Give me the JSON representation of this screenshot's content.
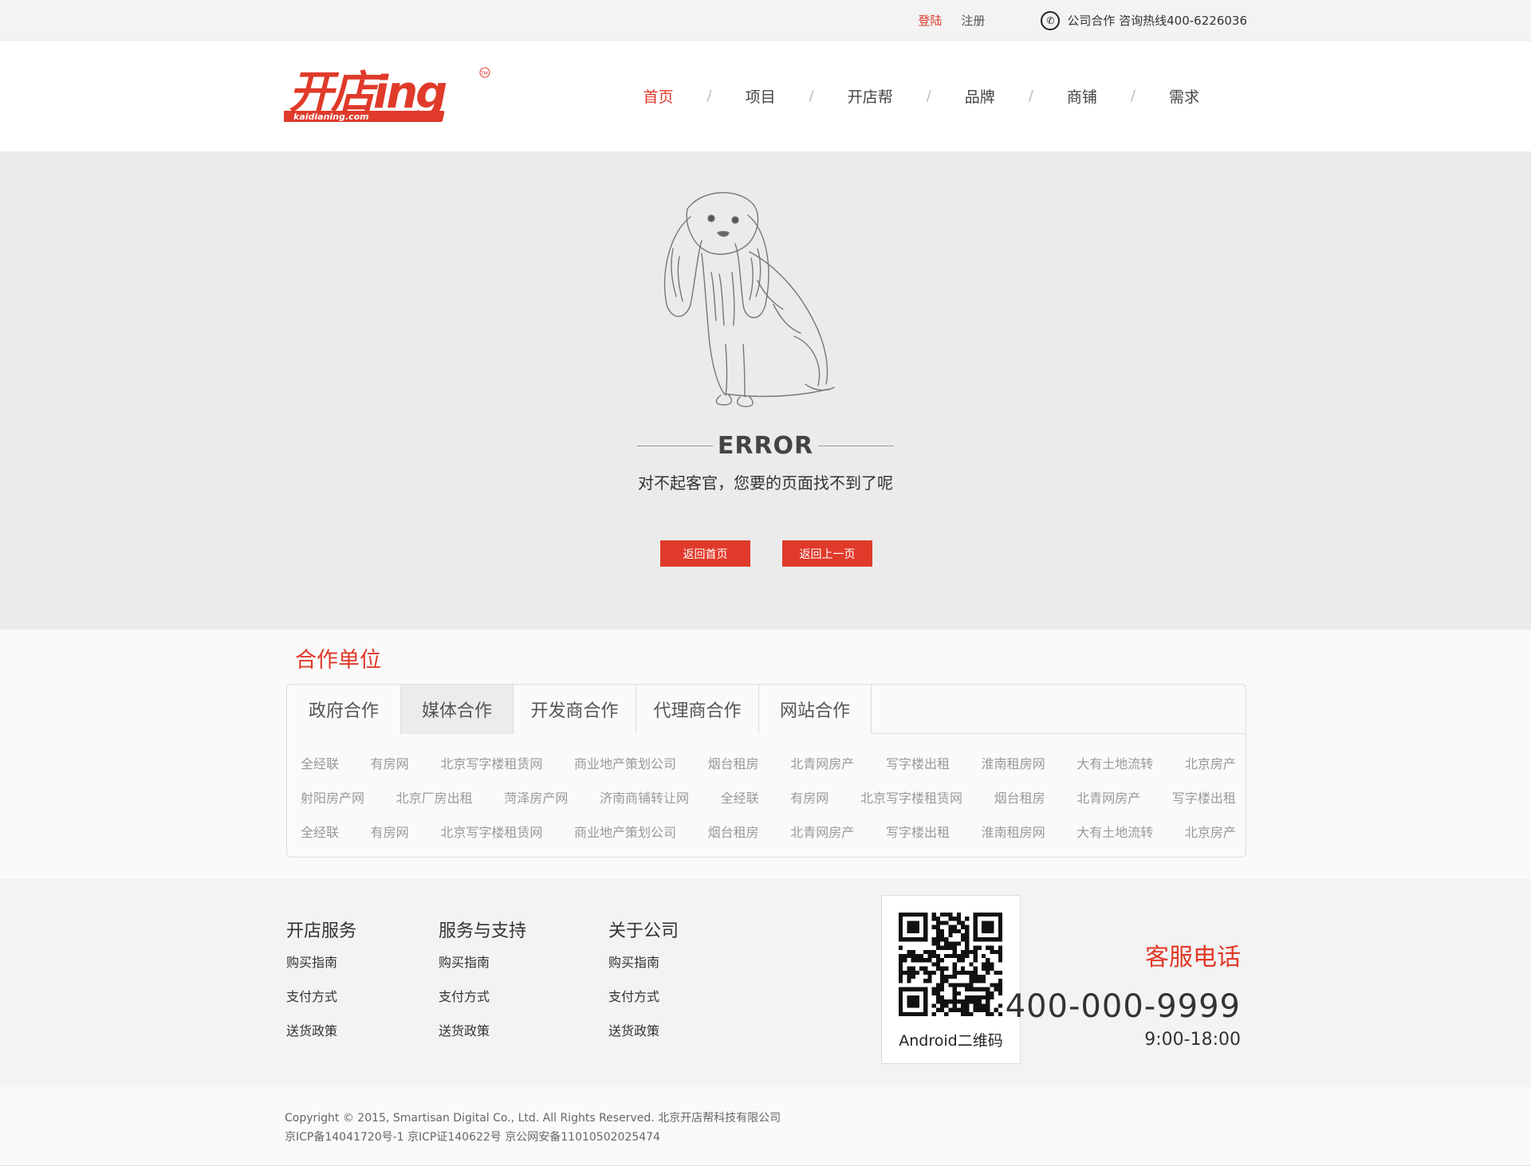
{
  "topbar": {
    "login": "登陆",
    "register": "注册",
    "hotline": "公司合作 咨询热线400-6226036"
  },
  "logo": {
    "text": "开店ing",
    "sub": "kaidianing.com",
    "mark": "TM"
  },
  "nav": {
    "items": [
      "首页",
      "项目",
      "开店帮",
      "品牌",
      "商铺",
      "需求"
    ],
    "separator": "/"
  },
  "error": {
    "title": "ERROR",
    "message": "对不起客官，您要的页面找不到了呢",
    "btn_home": "返回首页",
    "btn_back": "返回上一页"
  },
  "partners": {
    "title": "合作单位",
    "tabs": [
      "政府合作",
      "媒体合作",
      "开发商合作",
      "代理商合作",
      "网站合作"
    ],
    "active_tab": "媒体合作",
    "rows": [
      [
        "全经联",
        "有房网",
        "北京写字楼租赁网",
        "商业地产策划公司",
        "烟台租房",
        "北青网房产",
        "写字楼出租",
        "淮南租房网",
        "大有土地流转",
        "北京房产"
      ],
      [
        "射阳房产网",
        "北京厂房出租",
        "菏泽房产网",
        "济南商铺转让网",
        "全经联",
        "有房网",
        "北京写字楼租赁网",
        "烟台租房",
        "北青网房产",
        "写字楼出租"
      ],
      [
        "全经联",
        "有房网",
        "北京写字楼租赁网",
        "商业地产策划公司",
        "烟台租房",
        "北青网房产",
        "写字楼出租",
        "淮南租房网",
        "大有土地流转",
        "北京房产"
      ]
    ]
  },
  "footer": {
    "columns": [
      {
        "title": "开店服务",
        "links": [
          "购买指南",
          "支付方式",
          "送货政策"
        ]
      },
      {
        "title": "服务与支持",
        "links": [
          "购买指南",
          "支付方式",
          "送货政策"
        ]
      },
      {
        "title": "关于公司",
        "links": [
          "购买指南",
          "支付方式",
          "送货政策"
        ]
      }
    ],
    "qr_label": "Android二维码",
    "service_title": "客服电话",
    "service_phone": "400-000-9999",
    "service_hours": "9:00-18:00"
  },
  "copyright": {
    "line1": "Copyright © 2015, Smartisan Digital Co., Ltd. All Rights Reserved. 北京开店帮科技有限公司",
    "line2": "京ICP备14041720号-1 京ICP证140622号 京公网安备11010502025474"
  },
  "colors": {
    "accent": "#e03a2a",
    "hero_bg": "#ebebeb"
  }
}
